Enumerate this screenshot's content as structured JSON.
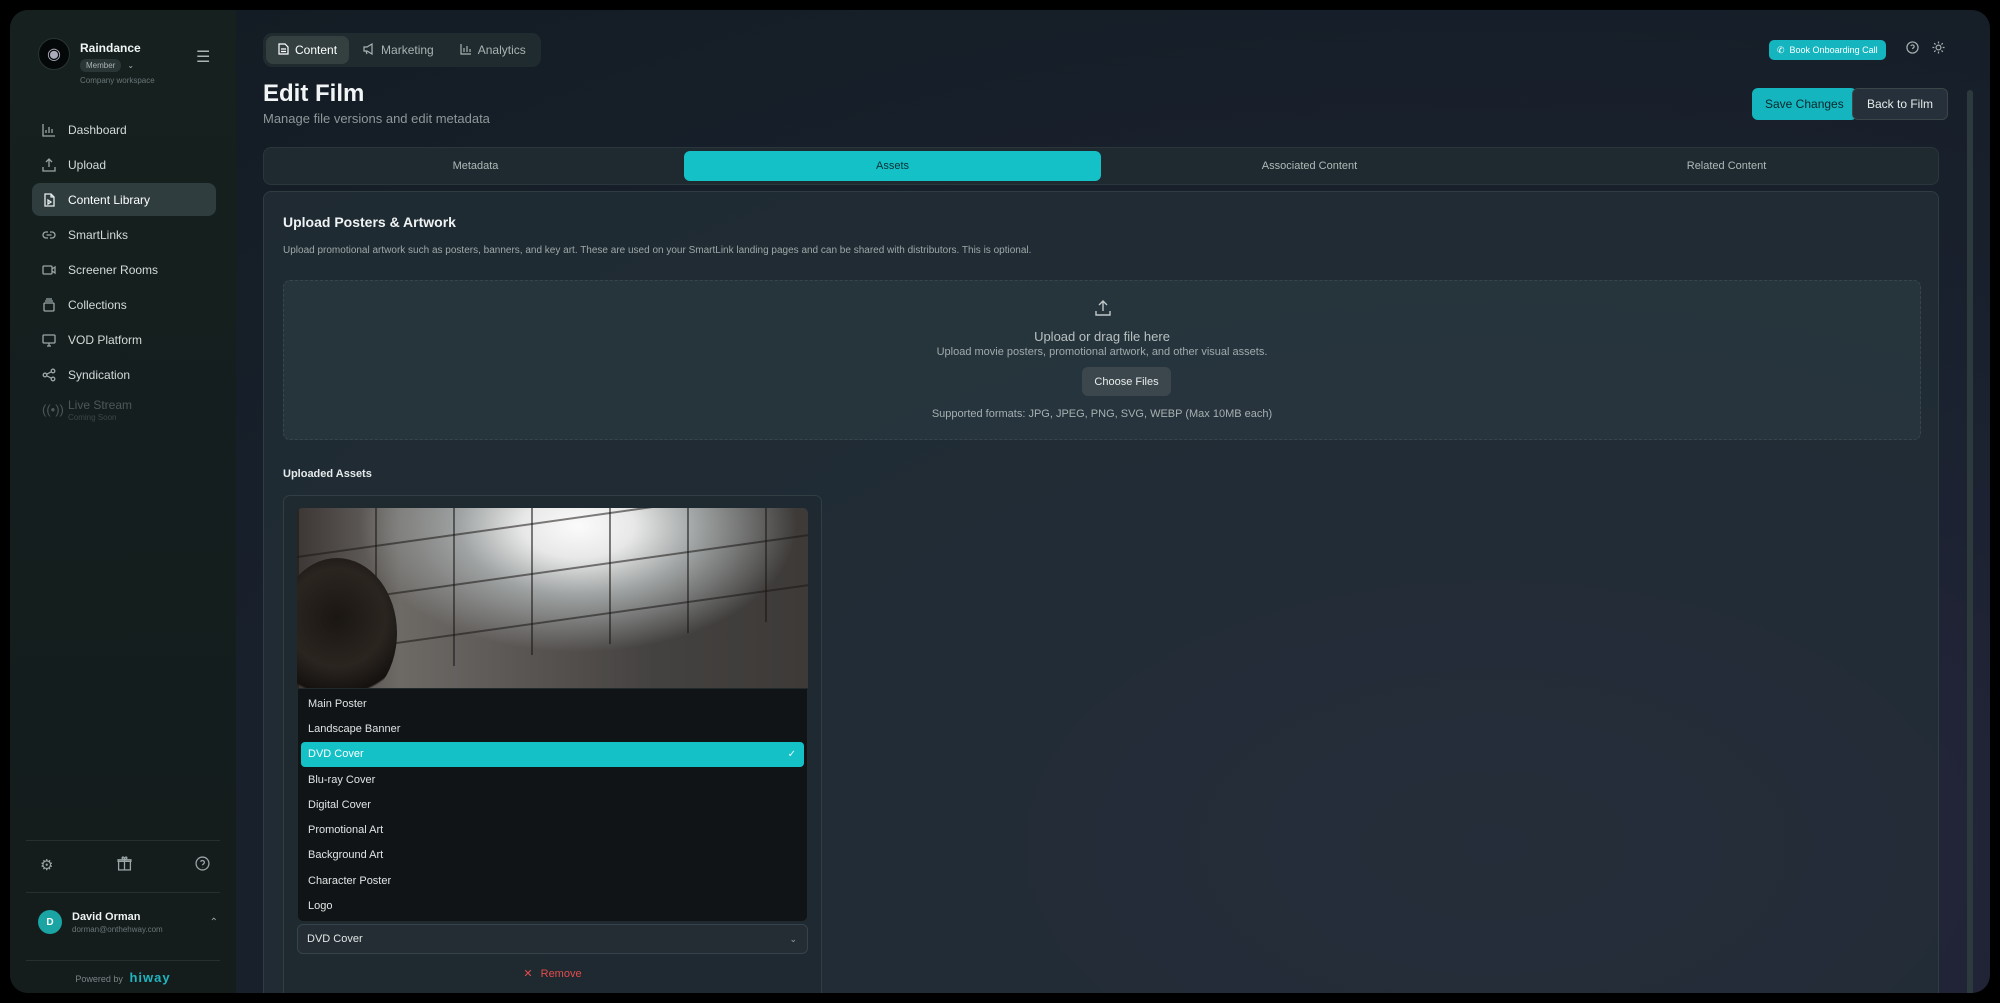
{
  "sidebar": {
    "brand_name": "Raindance",
    "role": "Member",
    "workspace": "Company workspace",
    "items": [
      {
        "label": "Dashboard",
        "icon": "chart-icon"
      },
      {
        "label": "Upload",
        "icon": "upload-icon"
      },
      {
        "label": "Content Library",
        "icon": "file-icon",
        "active": true
      },
      {
        "label": "SmartLinks",
        "icon": "link-icon"
      },
      {
        "label": "Screener Rooms",
        "icon": "video-icon"
      },
      {
        "label": "Collections",
        "icon": "stack-icon"
      },
      {
        "label": "VOD Platform",
        "icon": "monitor-icon"
      },
      {
        "label": "Syndication",
        "icon": "share-icon"
      },
      {
        "label": "Live Stream",
        "icon": "broadcast-icon",
        "sub": "Coming Soon",
        "disabled": true
      }
    ],
    "user": {
      "initial": "D",
      "name": "David Orman",
      "email": "dorman@onthehway.com"
    },
    "powered_label": "Powered by",
    "powered_brand": "hiway"
  },
  "header": {
    "tabs": [
      {
        "label": "Content",
        "icon": "document-icon",
        "active": true
      },
      {
        "label": "Marketing",
        "icon": "megaphone-icon"
      },
      {
        "label": "Analytics",
        "icon": "bar-chart-icon"
      }
    ],
    "book_label": "Book Onboarding Call"
  },
  "page": {
    "title": "Edit Film",
    "subtitle": "Manage file versions and edit metadata",
    "save_label": "Save Changes",
    "back_label": "Back to Film",
    "subtabs": [
      {
        "label": "Metadata"
      },
      {
        "label": "Assets",
        "active": true
      },
      {
        "label": "Associated Content"
      },
      {
        "label": "Related Content"
      }
    ]
  },
  "panel": {
    "title": "Upload Posters & Artwork",
    "description": "Upload promotional artwork such as posters, banners, and key art. These are used on your SmartLink landing pages and can be shared with distributors. This is optional.",
    "drop_title": "Upload or drag file here",
    "drop_sub": "Upload movie posters, promotional artwork, and other visual assets.",
    "choose_label": "Choose Files",
    "formats": "Supported formats: JPG, JPEG, PNG, SVG, WEBP (Max 10MB each)",
    "uploaded_title": "Uploaded Assets",
    "asset_type_options": [
      "Main Poster",
      "Landscape Banner",
      "DVD Cover",
      "Blu-ray Cover",
      "Digital Cover",
      "Promotional Art",
      "Background Art",
      "Character Poster",
      "Logo"
    ],
    "selected_type": "DVD Cover",
    "remove_label": "Remove"
  },
  "colors": {
    "accent": "#14c1c7",
    "danger": "#e24c4c"
  }
}
